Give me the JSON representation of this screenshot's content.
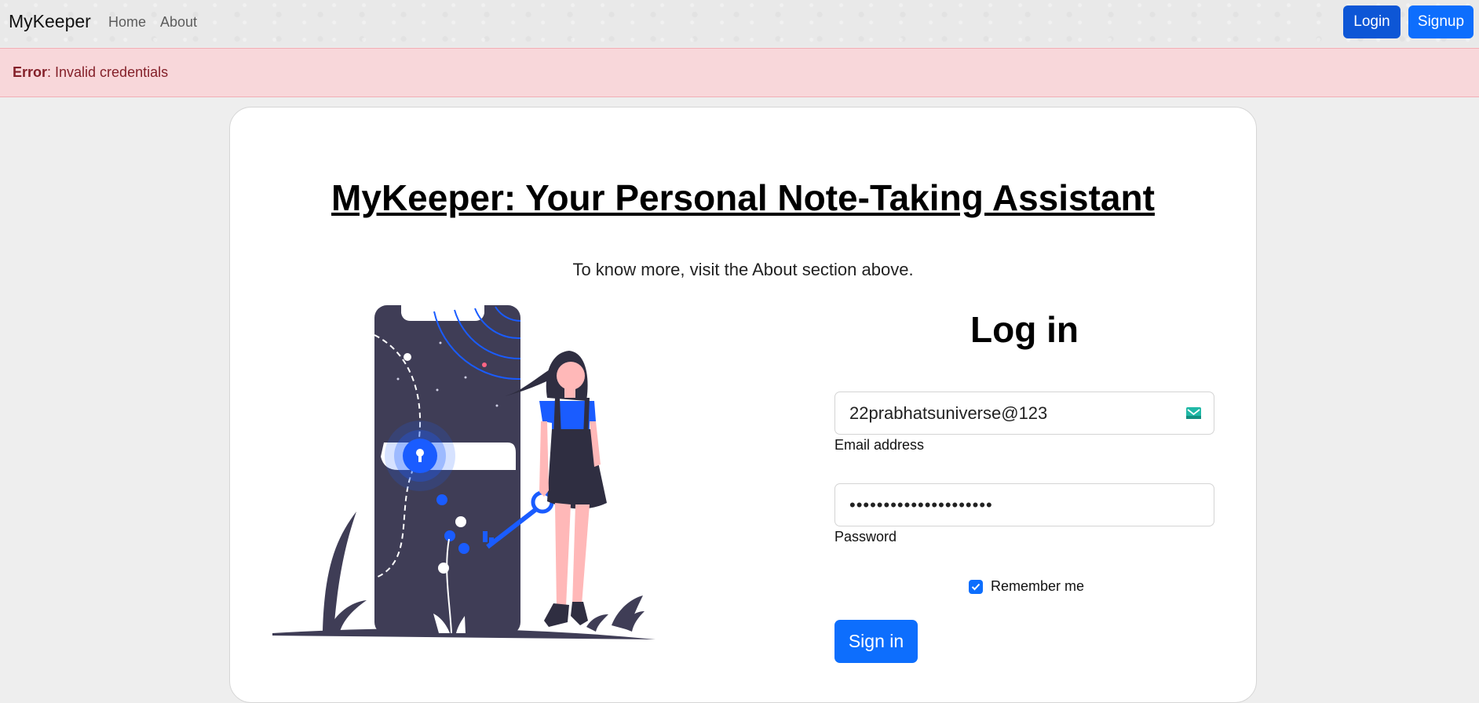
{
  "navbar": {
    "brand": "MyKeeper",
    "links": [
      {
        "label": "Home"
      },
      {
        "label": "About"
      }
    ],
    "login_label": "Login",
    "signup_label": "Signup"
  },
  "alert": {
    "prefix": "Error",
    "message": ": Invalid credentials"
  },
  "hero": {
    "title": "MyKeeper: Your Personal Note-Taking Assistant",
    "subtitle": "To know more, visit the About section above."
  },
  "login_form": {
    "title": "Log in",
    "email_value": "22prabhatsuniverse@123",
    "email_label": "Email address",
    "password_value": "•••••••••••••••••••••",
    "password_label": "Password",
    "remember_label": "Remember me",
    "remember_checked": true,
    "submit_label": "Sign in"
  },
  "icons": {
    "email": "envelope-icon",
    "checkbox": "check-icon"
  },
  "colors": {
    "primary": "#0d6efd",
    "alert_bg": "#f8d7da",
    "alert_text": "#842029",
    "illustration_dark": "#3f3d56",
    "illustration_accent": "#1a5cff"
  }
}
